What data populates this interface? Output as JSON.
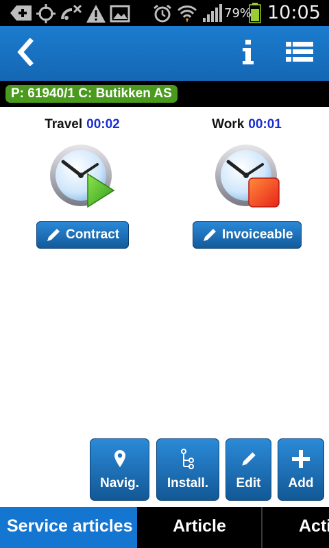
{
  "status_bar": {
    "icons": [
      "add-icon",
      "gps-icon",
      "no-signal-dish-icon",
      "warning-icon",
      "image-icon",
      "alarm-icon",
      "wifi-icon",
      "signal-icon",
      "battery-icon"
    ],
    "battery_percent": "79%",
    "time": "10:05"
  },
  "action_bar": {
    "back_icon": "chevron-left-icon",
    "info_icon": "info-icon",
    "menu_icon": "list-icon"
  },
  "project": {
    "label": "P: 61940/1 C: Butikken AS",
    "accent": "#4a9a1d"
  },
  "timers": [
    {
      "label": "Travel",
      "value": "00:02",
      "state": "play",
      "button": "Contract"
    },
    {
      "label": "Work",
      "value": "00:01",
      "state": "stop",
      "button": "Invoiceable"
    }
  ],
  "actions": [
    {
      "label": "Navig.",
      "icon": "map-pin-icon"
    },
    {
      "label": "Install.",
      "icon": "tree-icon"
    },
    {
      "label": "Edit",
      "icon": "pencil-icon"
    },
    {
      "label": "Add",
      "icon": "plus-icon"
    }
  ],
  "tabs": [
    {
      "label": "Service articles",
      "active": true
    },
    {
      "label": "Article",
      "active": false
    },
    {
      "label": "Acti",
      "active": false
    }
  ],
  "colors": {
    "action_bar": "#1a74c6",
    "button": "#1c73c0",
    "timer_value": "#1c2fd0",
    "tab_active": "#1576d1"
  }
}
